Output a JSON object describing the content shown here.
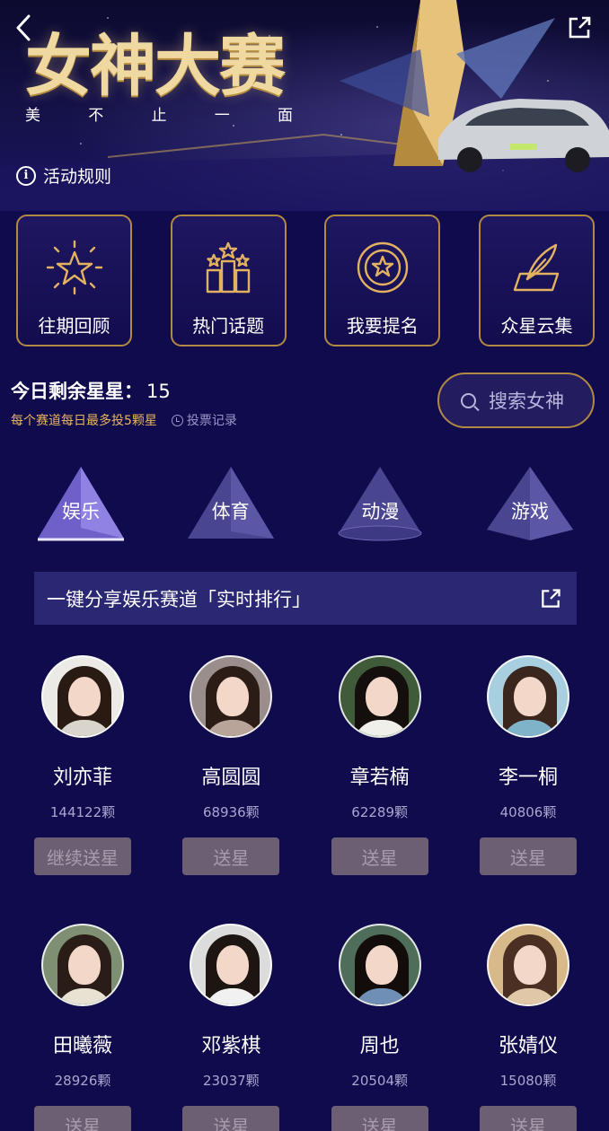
{
  "hero": {
    "title": "女神大赛",
    "subtitle_chars": [
      "美",
      "不",
      "止",
      "一",
      "面"
    ],
    "rules_label": "活动规则"
  },
  "menu": [
    {
      "label": "往期回顾",
      "icon": "starburst-icon"
    },
    {
      "label": "热门话题",
      "icon": "podium-stars-icon"
    },
    {
      "label": "我要提名",
      "icon": "star-badge-icon"
    },
    {
      "label": "众星云集",
      "icon": "quill-icon"
    }
  ],
  "stars_info": {
    "remaining_label": "今日剩余星星：",
    "remaining_count": "15",
    "rule_note": "每个赛道每日最多投5颗星",
    "vote_record_label": "投票记录"
  },
  "search": {
    "placeholder": "搜索女神"
  },
  "categories": [
    {
      "label": "娱乐",
      "active": true
    },
    {
      "label": "体育",
      "active": false
    },
    {
      "label": "动漫",
      "active": false
    },
    {
      "label": "游戏",
      "active": false
    }
  ],
  "share_bar": {
    "label": "一键分享娱乐赛道「实时排行」"
  },
  "contestants": [
    {
      "name": "刘亦菲",
      "count": "144122颗",
      "button": "继续送星",
      "hair": "#2a1a14",
      "body": "#d9d4cc"
    },
    {
      "name": "高圆圆",
      "count": "68936颗",
      "button": "送星",
      "hair": "#2b1d16",
      "body": "#b9a49a"
    },
    {
      "name": "章若楠",
      "count": "62289颗",
      "button": "送星",
      "hair": "#140e0c",
      "body": "#f0efe9"
    },
    {
      "name": "李一桐",
      "count": "40806颗",
      "button": "送星",
      "hair": "#3a261c",
      "body": "#7fb3c9"
    },
    {
      "name": "田曦薇",
      "count": "28926颗",
      "button": "送星",
      "hair": "#2a1d17",
      "body": "#e7e2d2"
    },
    {
      "name": "邓紫棋",
      "count": "23037颗",
      "button": "送星",
      "hair": "#1d1512",
      "body": "#f1f1f1"
    },
    {
      "name": "周也",
      "count": "20504颗",
      "button": "送星",
      "hair": "#120c0b",
      "body": "#6f8fb6"
    },
    {
      "name": "张婧仪",
      "count": "15080颗",
      "button": "送星",
      "hair": "#4a2f22",
      "body": "#e0c7a8"
    }
  ],
  "colors": {
    "background": "#100b4c",
    "gold": "#b28a44",
    "gold_text": "#e8b45a",
    "button_bg": "#6d5f73",
    "share_bar_bg": "#2a2773"
  }
}
